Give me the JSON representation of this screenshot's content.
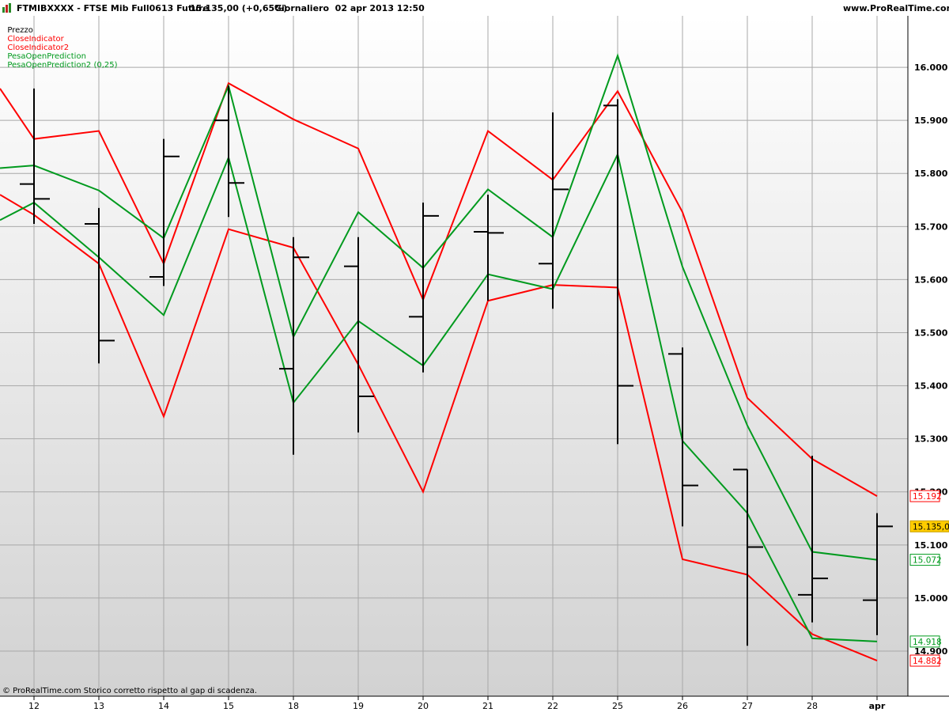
{
  "header": {
    "symbol": "FTMIBXXXX - FTSE Mib Full0613 Future",
    "price_change": "15.135,00 (+0,65%)",
    "period_date": "Giornaliero  02 apr 2013 12:50",
    "site": "www.ProRealTime.com"
  },
  "legend": {
    "price": "Prezzo",
    "close1": "CloseIndicator",
    "close2": "CloseIndicator2",
    "pesa1": "PesaOpenPrediction",
    "pesa2": "PesaOpenPrediction2 (0,25)"
  },
  "footer": "© ProRealTime.com  Storico corretto rispetto al gap di scadenza.",
  "colors": {
    "red": "#ff0000",
    "green": "#009a1e",
    "bars": "#000000",
    "current": "#ffcc00"
  },
  "chart_data": {
    "type": "ohlc",
    "categories": [
      "12",
      "13",
      "14",
      "15",
      "18",
      "19",
      "20",
      "21",
      "22",
      "25",
      "26",
      "27",
      "28",
      "apr"
    ],
    "yticks": [
      "16.000",
      "15.900",
      "15.800",
      "15.700",
      "15.600",
      "15.500",
      "15.400",
      "15.300",
      "15.200",
      "15.100",
      "15.000",
      "14.900"
    ],
    "ytick_values": [
      16000,
      15900,
      15800,
      15700,
      15600,
      15500,
      15400,
      15300,
      15200,
      15100,
      15000,
      14900
    ],
    "ylim": [
      14815,
      16097
    ],
    "ohlc": [
      {
        "o": 15780,
        "h": 15960,
        "l": 15705,
        "c": 15752
      },
      {
        "o": 15705,
        "h": 15735,
        "l": 15442,
        "c": 15485
      },
      {
        "o": 15605,
        "h": 15865,
        "l": 15588,
        "c": 15832
      },
      {
        "o": 15900,
        "h": 15965,
        "l": 15718,
        "c": 15782
      },
      {
        "o": 15432,
        "h": 15680,
        "l": 15270,
        "c": 15642
      },
      {
        "o": 15625,
        "h": 15680,
        "l": 15312,
        "c": 15380
      },
      {
        "o": 15530,
        "h": 15745,
        "l": 15425,
        "c": 15720
      },
      {
        "o": 15690,
        "h": 15760,
        "l": 15560,
        "c": 15688
      },
      {
        "o": 15630,
        "h": 15915,
        "l": 15545,
        "c": 15770
      },
      {
        "o": 15928,
        "h": 15940,
        "l": 15290,
        "c": 15400
      },
      {
        "o": 15460,
        "h": 15472,
        "l": 15135,
        "c": 15212
      },
      {
        "o": 15242,
        "h": 15242,
        "l": 14910,
        "c": 15096
      },
      {
        "o": 15006,
        "h": 15268,
        "l": 14954,
        "c": 15037
      },
      {
        "o": 14996,
        "h": 15160,
        "l": 14930,
        "c": 15135
      }
    ],
    "series": [
      {
        "name": "CloseIndicator",
        "color": "#ff0000",
        "values": [
          15722,
          15630,
          15342,
          15695,
          15660,
          15440,
          15200,
          15560,
          15590,
          15585,
          15073,
          15044,
          14932,
          14882
        ],
        "start": 15760
      },
      {
        "name": "CloseIndicator2",
        "color": "#ff0000",
        "values": [
          15865,
          15880,
          15630,
          15970,
          15902,
          15847,
          15562,
          15880,
          15788,
          15955,
          15727,
          15377,
          15262,
          15192
        ],
        "start": 15960
      },
      {
        "name": "PesaOpenPrediction",
        "color": "#009a1e",
        "values": [
          15815,
          15768,
          15678,
          15965,
          15492,
          15727,
          15622,
          15770,
          15680,
          16022,
          15624,
          15325,
          15087,
          15072
        ],
        "start": 15810
      },
      {
        "name": "PesaOpenPrediction2 (0,25)",
        "color": "#009a1e",
        "values": [
          15745,
          15642,
          15533,
          15830,
          15368,
          15522,
          15438,
          15610,
          15582,
          15836,
          15296,
          15160,
          14924,
          14918
        ],
        "start": 15712
      }
    ],
    "last_labels": [
      {
        "text": "15.192",
        "value": 15192,
        "color": "#ff0000"
      },
      {
        "text": "15.135,00",
        "value": 15135,
        "color": "#000000",
        "bg": "#ffcc00"
      },
      {
        "text": "15.072",
        "value": 15072,
        "color": "#009a1e"
      },
      {
        "text": "14.918",
        "value": 14918,
        "color": "#009a1e"
      },
      {
        "text": "14.882",
        "value": 14882,
        "color": "#ff0000"
      }
    ]
  }
}
